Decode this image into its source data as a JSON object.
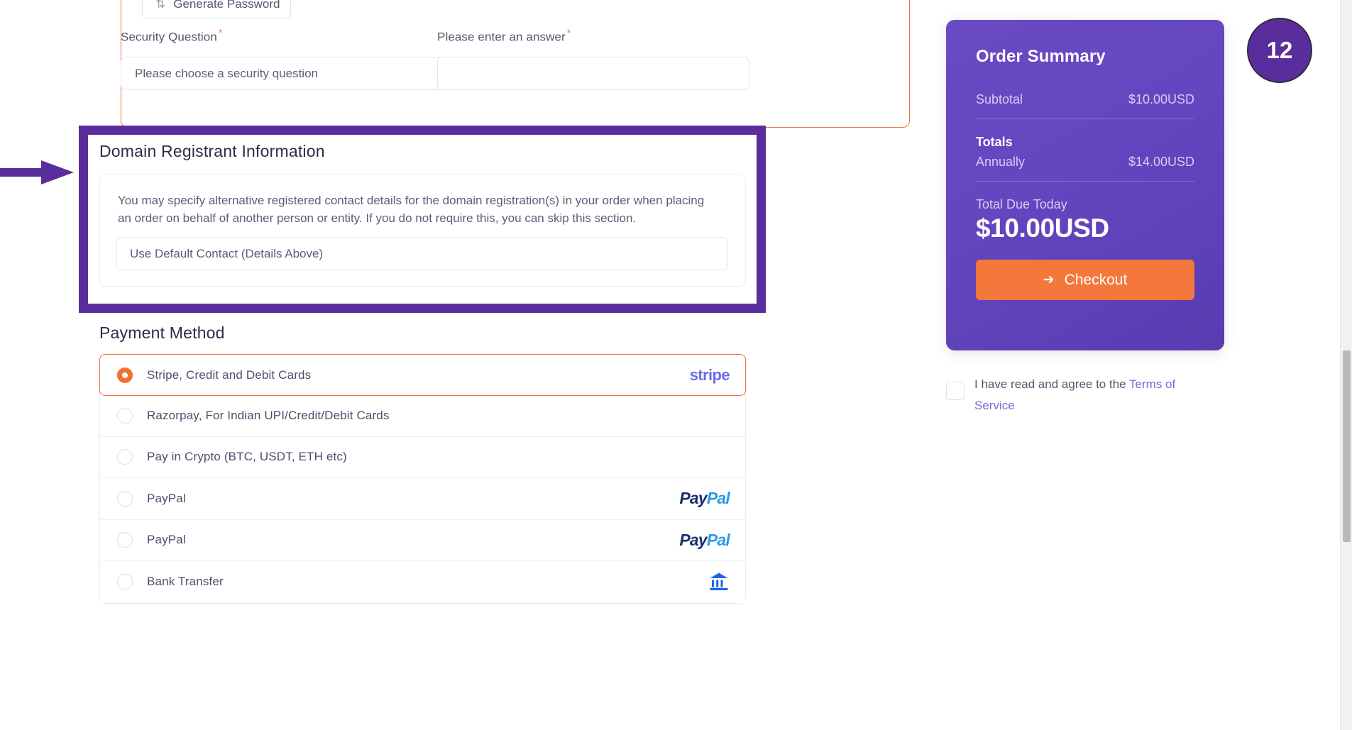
{
  "top_form": {
    "generate_password_label": "Generate Password",
    "generate_password_icon": "refresh-icon",
    "security_question_label": "Security Question",
    "security_question_value": "Please choose a security question",
    "answer_label": "Please enter an answer",
    "answer_value": "",
    "required_marker": "*"
  },
  "registrant": {
    "title": "Domain Registrant Information",
    "description": "You may specify alternative registered contact details for the domain registration(s) in your order when placing an order on behalf of another person or entity. If you do not require this, you can skip this section.",
    "contact_select_value": "Use Default Contact (Details Above)"
  },
  "payment": {
    "title": "Payment Method",
    "methods": [
      {
        "label": "Stripe, Credit and Debit Cards",
        "selected": true,
        "logo": "stripe",
        "logo_text": "stripe"
      },
      {
        "label": "Razorpay, For Indian UPI/Credit/Debit Cards",
        "selected": false,
        "logo": "none",
        "logo_text": ""
      },
      {
        "label": "Pay in Crypto (BTC, USDT, ETH etc)",
        "selected": false,
        "logo": "none",
        "logo_text": ""
      },
      {
        "label": "PayPal",
        "selected": false,
        "logo": "paypal",
        "logo_text": "PayPal"
      },
      {
        "label": "PayPal",
        "selected": false,
        "logo": "paypal",
        "logo_text": "PayPal"
      },
      {
        "label": "Bank Transfer",
        "selected": false,
        "logo": "bank",
        "logo_text": "bank-icon"
      }
    ]
  },
  "order_summary": {
    "title": "Order Summary",
    "subtotal_label": "Subtotal",
    "subtotal_value": "$10.00USD",
    "totals_label": "Totals",
    "annually_label": "Annually",
    "annually_value": "$14.00USD",
    "total_due_label": "Total Due Today",
    "total_due_value": "$10.00USD",
    "checkout_label": "Checkout",
    "checkout_icon": "arrow-right-icon"
  },
  "terms": {
    "text_before": "I have read and agree to the ",
    "link_text": "Terms of Service",
    "checked": false
  },
  "annotation": {
    "step_number": "12",
    "arrow_icon": "arrow-right-annotation",
    "highlight_color": "#5a2d9c"
  },
  "colors": {
    "accent_orange": "#f1702f",
    "brand_purple": "#6346c0",
    "annotation_purple": "#5a2d9c",
    "stripe_blue": "#6b6bee",
    "paypal_dark": "#18306d",
    "paypal_light": "#2b9ce5",
    "bank_blue": "#1a66e0"
  }
}
